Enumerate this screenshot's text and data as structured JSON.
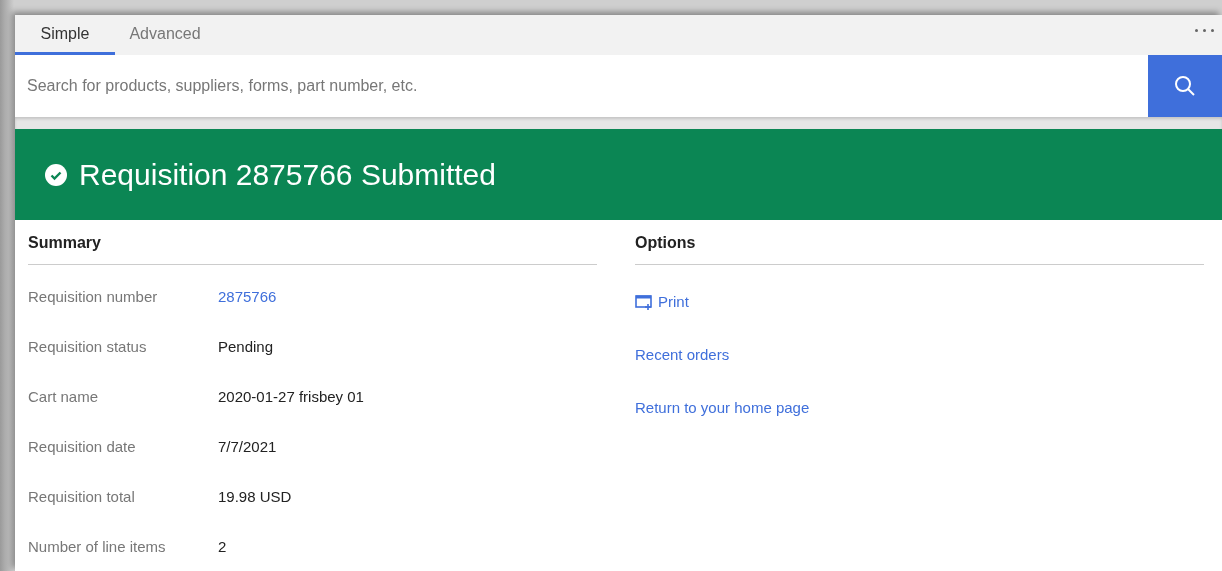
{
  "tabs": [
    {
      "label": "Simple",
      "selected": true
    },
    {
      "label": "Advanced",
      "selected": false
    }
  ],
  "search": {
    "placeholder": "Search for products, suppliers, forms, part number, etc."
  },
  "banner": {
    "title": "Requisition 2875766 Submitted"
  },
  "summary": {
    "heading": "Summary",
    "rows": [
      {
        "label": "Requisition number",
        "value": "2875766",
        "kind": "link"
      },
      {
        "label": "Requisition status",
        "value": "Pending",
        "kind": "text"
      },
      {
        "label": "Cart name",
        "value": "2020-01-27 frisbey 01",
        "kind": "text"
      },
      {
        "label": "Requisition date",
        "value": "7/7/2021",
        "kind": "text"
      },
      {
        "label": "Requisition total",
        "value": "19.98 USD",
        "kind": "text"
      },
      {
        "label": "Number of line items",
        "value": "2",
        "kind": "text"
      }
    ]
  },
  "options": {
    "heading": "Options",
    "items": [
      {
        "label": "Print",
        "kind": "print"
      },
      {
        "label": "Recent orders",
        "kind": "link"
      },
      {
        "label": "Return to your home page",
        "kind": "link"
      }
    ]
  }
}
